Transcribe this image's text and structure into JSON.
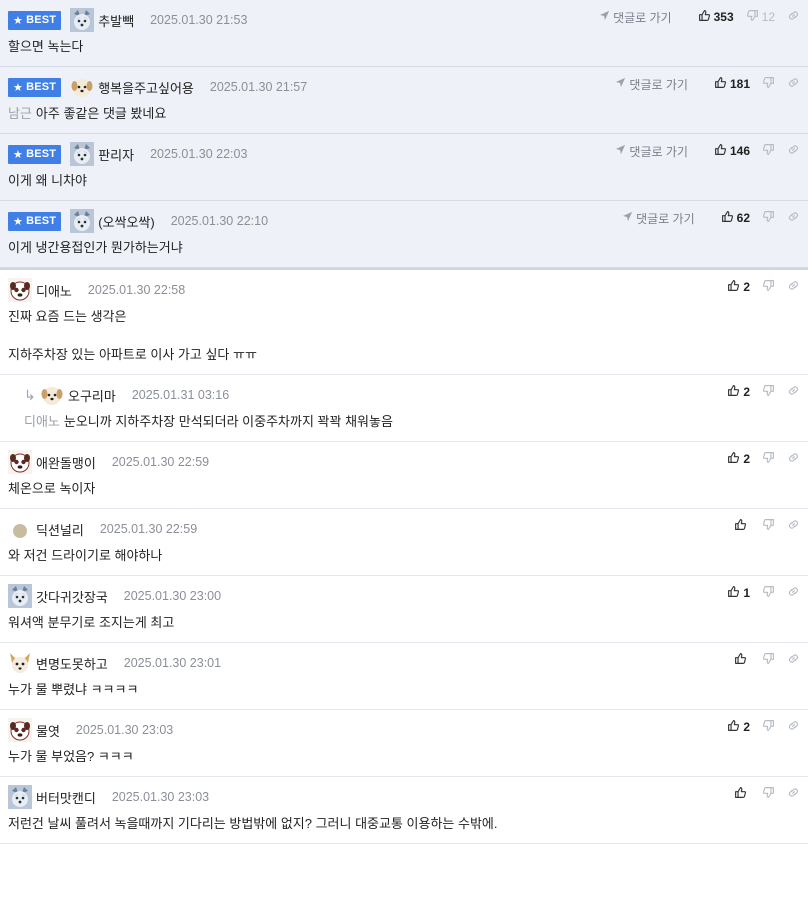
{
  "labels": {
    "best": "BEST",
    "goto": "댓글로 가기"
  },
  "colors": {
    "best_badge": "#3f7fe6",
    "best_row_bg": "#eef1f8"
  },
  "best_comments": [
    {
      "nick": "추발빽",
      "date": "2025.01.30 21:53",
      "text": "할으면 녹는다",
      "mention": "",
      "up": "353",
      "down": "12",
      "avatar": "husky-avatar"
    },
    {
      "nick": "행복을주고싶어용",
      "date": "2025.01.30 21:57",
      "text": "아주 좋같은 댓글 봤네요",
      "mention": "남근",
      "up": "181",
      "down": "",
      "avatar": "puppy-avatar"
    },
    {
      "nick": "판리자",
      "date": "2025.01.30 22:03",
      "text": "이게 왜 니차야",
      "mention": "",
      "up": "146",
      "down": "",
      "avatar": "husky-avatar"
    },
    {
      "nick": "(오싹오싹)",
      "date": "2025.01.30 22:10",
      "text": "이게 냉간용접인가 뭔가하는거냐",
      "mention": "",
      "up": "62",
      "down": "",
      "avatar": "husky-avatar"
    }
  ],
  "comments": [
    {
      "nick": "디애노",
      "date": "2025.01.30 22:58",
      "lines": [
        "진짜 요즘 드는 생각은",
        "",
        "지하주차장 있는 아파트로 이사 가고 싶다 ㅠㅠ"
      ],
      "mention": "",
      "up": "2",
      "reply": false,
      "avatar": "pug-avatar"
    },
    {
      "nick": "오구리마",
      "date": "2025.01.31 03:16",
      "lines": [
        "눈오니까 지하주차장 만석되더라 이중주차까지 꽉꽉 채워놓음"
      ],
      "mention": "디애노",
      "up": "2",
      "reply": true,
      "avatar": "puppy-avatar"
    },
    {
      "nick": "애완돌맹이",
      "date": "2025.01.30 22:59",
      "lines": [
        "체온으로 녹이자"
      ],
      "mention": "",
      "up": "2",
      "reply": false,
      "avatar": "pug-avatar"
    },
    {
      "nick": "딕션널리",
      "date": "2025.01.30 22:59",
      "lines": [
        "와 저건 드라이기로 해야하나"
      ],
      "mention": "",
      "up": "",
      "reply": false,
      "avatar": "circle-avatar"
    },
    {
      "nick": "갓다귀갓장국",
      "date": "2025.01.30 23:00",
      "lines": [
        "워셔액 분무기로 조지는게 최고"
      ],
      "mention": "",
      "up": "1",
      "reply": false,
      "avatar": "husky-avatar"
    },
    {
      "nick": "변명도못하고",
      "date": "2025.01.30 23:01",
      "lines": [
        "누가 물 뿌렸냐 ㅋㅋㅋㅋ"
      ],
      "mention": "",
      "up": "",
      "reply": false,
      "avatar": "chihuahua-avatar"
    },
    {
      "nick": "물엿",
      "date": "2025.01.30 23:03",
      "lines": [
        "누가 물 부었음? ㅋㅋㅋ"
      ],
      "mention": "",
      "up": "2",
      "reply": false,
      "avatar": "pug-avatar"
    },
    {
      "nick": "버터맛캔디",
      "date": "2025.01.30 23:03",
      "lines": [
        "저런건 날씨 풀려서 녹을때까지 기다리는 방법밖에 없지? 그러니 대중교통 이용하는 수밖에."
      ],
      "mention": "",
      "up": "",
      "reply": false,
      "avatar": "husky-avatar"
    }
  ]
}
